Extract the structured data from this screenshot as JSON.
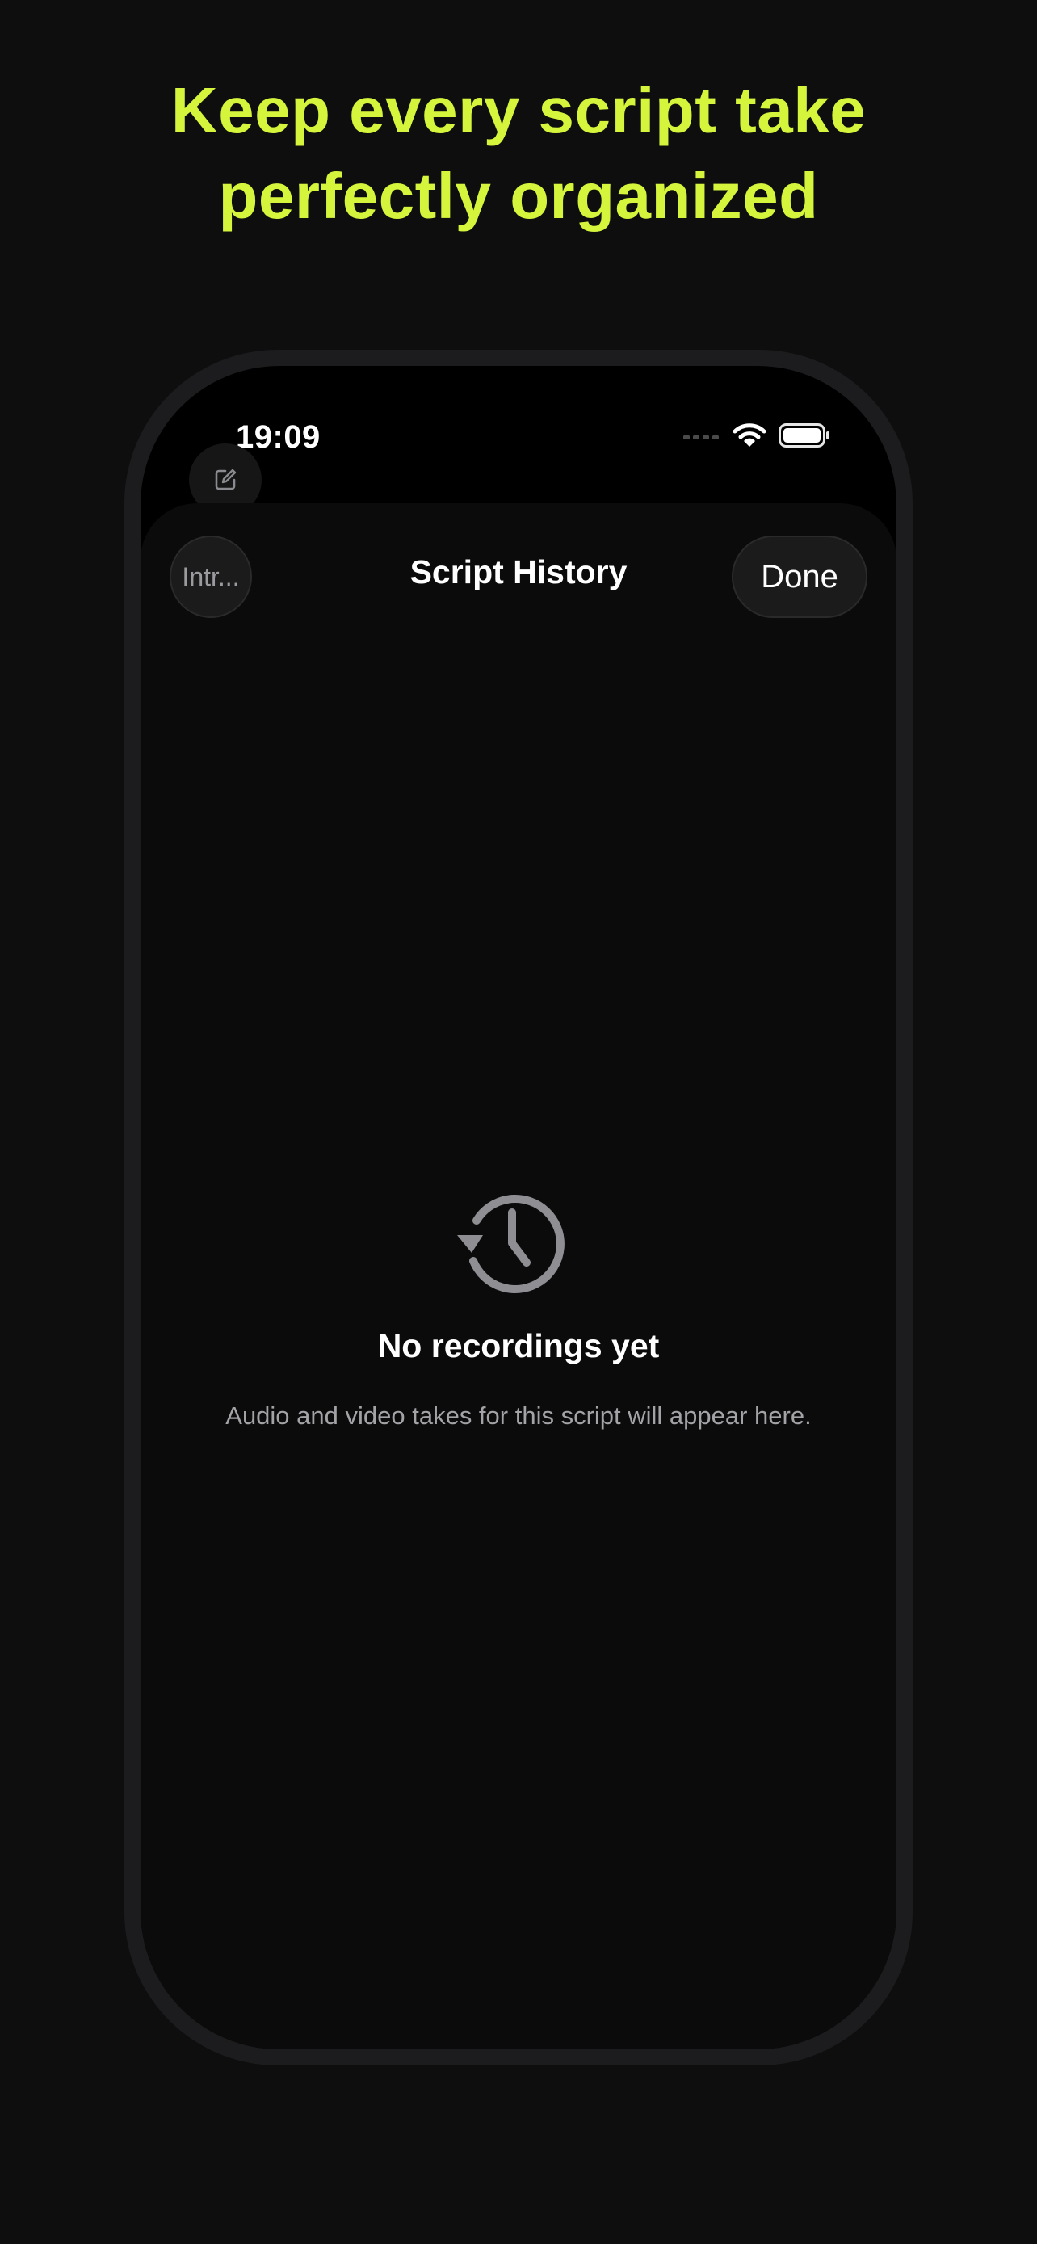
{
  "promo": {
    "headline_line1": "Keep every script take",
    "headline_line2": "perfectly organized",
    "accent_color": "#d4f53c"
  },
  "status_bar": {
    "time": "19:09",
    "icons": [
      "signal-icon",
      "wifi-icon",
      "battery-icon"
    ]
  },
  "toolbar": {
    "compose_icon": "compose-icon"
  },
  "sheet": {
    "back_label": "Intr...",
    "title": "Script History",
    "done_label": "Done"
  },
  "empty_state": {
    "icon": "history-icon",
    "title": "No recordings yet",
    "subtitle": "Audio and video takes for this script will appear here."
  }
}
